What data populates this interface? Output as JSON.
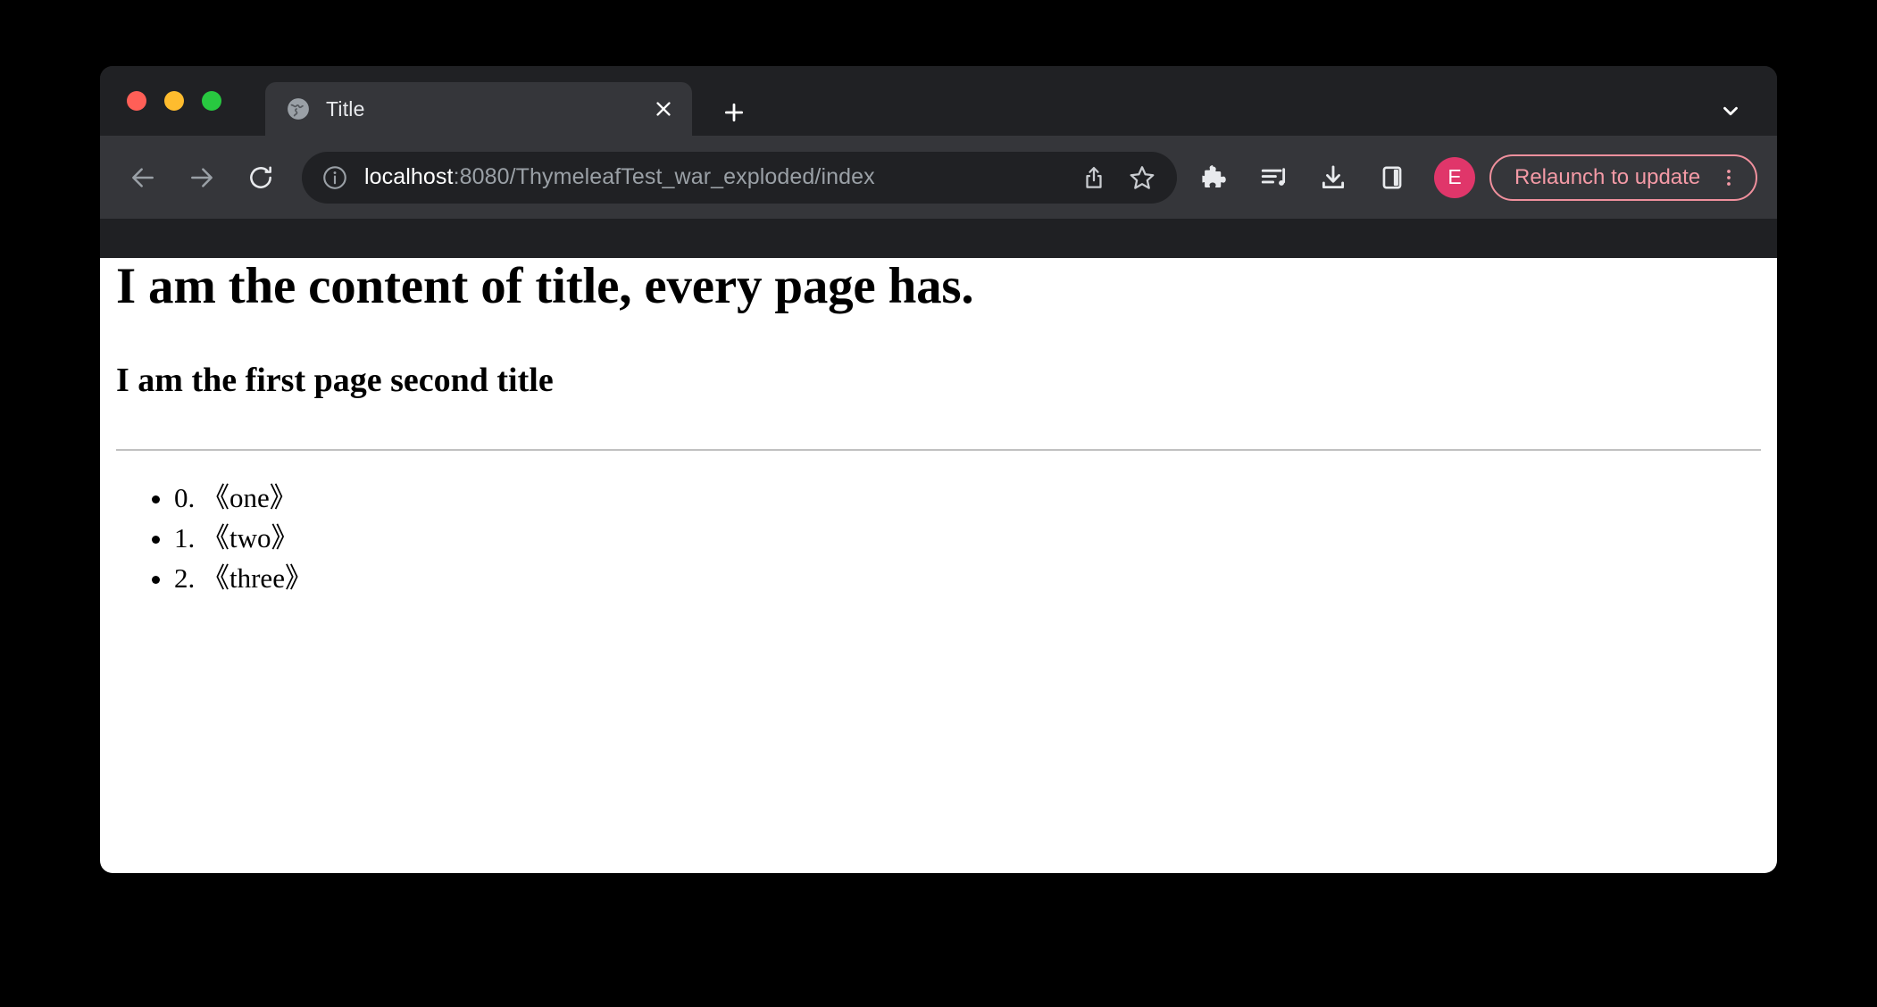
{
  "window": {
    "traffic_lights": [
      {
        "name": "close",
        "color": "#ff5f57"
      },
      {
        "name": "minimize",
        "color": "#febc2e"
      },
      {
        "name": "maximize",
        "color": "#28c840"
      }
    ]
  },
  "tab_strip": {
    "active_tab": {
      "title": "Title",
      "favicon": "globe-icon",
      "close_icon": "close-icon"
    },
    "new_tab_icon": "plus-icon",
    "chevron_icon": "chevron-down-icon"
  },
  "toolbar": {
    "back_icon": "arrow-left-icon",
    "forward_icon": "arrow-right-icon",
    "reload_icon": "reload-icon",
    "omnibox": {
      "site_info_icon": "info-icon",
      "url_host": "localhost",
      "url_rest": ":8080/ThymeleafTest_war_exploded/index",
      "url_full": "localhost:8080/ThymeleafTest_war_exploded/index",
      "share_icon": "share-icon",
      "bookmark_icon": "star-icon"
    },
    "actions": [
      {
        "name": "extensions-icon",
        "label": "Extensions"
      },
      {
        "name": "media-playlist-icon",
        "label": "Media"
      },
      {
        "name": "download-icon",
        "label": "Downloads"
      },
      {
        "name": "side-panel-icon",
        "label": "Side panel"
      }
    ],
    "avatar": {
      "initial": "E",
      "color": "#e0366a"
    },
    "update_pill": {
      "label": "Relaunch to update",
      "text_color": "#f49aa6",
      "border_color": "#f0909d",
      "menu_icon": "three-dot-menu-icon"
    }
  },
  "page": {
    "heading_primary": "I am the content of title, every page has.",
    "heading_secondary": "I am the first page second title",
    "list_items": [
      "0. 《one》",
      "1. 《two》",
      "2. 《three》"
    ]
  }
}
